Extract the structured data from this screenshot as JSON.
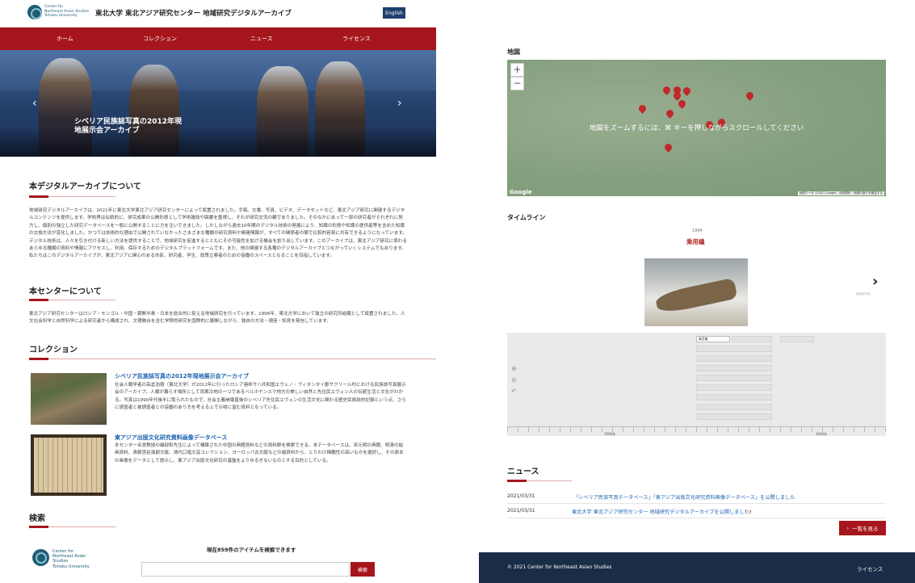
{
  "header": {
    "logo_text": "Center for\nNortheast Asian Studies\nTohoku University",
    "site_title": "東北大学 東北アジア研究センター 地域研究デジタルアーカイブ",
    "lang_button": "English"
  },
  "nav": {
    "items": [
      "ホーム",
      "コレクション",
      "ニュース",
      "ライセンス"
    ]
  },
  "hero": {
    "caption": "シベリア民族誌写真の2012年現\n地展示会アーカイブ",
    "prev": "‹",
    "next": "›"
  },
  "about": {
    "title": "本デジタルアーカイブについて",
    "text": "地域研究デジタルアーカイブは、2021年に東北大学東北アジア研究センターによって設置されました。手稿、文書、写真、ビデオ、データセットなど、東北アジア研究に関連するデジタルコンテンツを提供します。学術界は伝統的に、研究成果の公開形態として学術雑誌や図書を重視し、それが研究交流の鍵でありました。そのなかにあって一部の研究者がそれぞれに努力し、個別の独立した研究データベースを一般に公開することに力を注いできました。しかしながら過去10年間のデジタル技術の発展により、知識の形態や知識の提供者等を含めた知識の交換方法が変化しました。かつては技術的な理由で公開されていなかったさまざまな種類の研究資料や関連情報が、すべての関係者の間で比較的容易に共有できるようになっています。デジタル技術は、人々を引き付ける新しい方法を提供することで、地域研究を促進するとともにその可能性を拡げる機会を創り出しています。このアーカイブは、東北アジア研究に係わるあらゆる種類の資料や情報にアクセスし、利用、保存するためのデジタルプラットフォームです。また、他の関連する各種のデジタルアーカイブとつながっていくシステムでもあります。私たちはこのデジタルアーカイブが、東北アジアに関心のある市民、研究者、学生、政策立案者のための協働のスペースとなることを目指しています。"
  },
  "center": {
    "title": "本センターについて",
    "text": "東北アジア研究センターはロシア・モンゴル・中国・朝鮮半島・日本を総合的に捉える地域研究を行っています。1996年、東北大学において独立の研究所組織として設置されました。人文社会科学と自然科学による研究者から構成され、文理融合を含む学際的研究を国際的に展開しながら、独自の方法・視座・知見を発信しています。"
  },
  "collection": {
    "title": "コレクション",
    "items": [
      {
        "title": "シベリア民族誌写真の2012年現地展示会アーカイブ",
        "desc": "社会人類学者の高倉浩樹（東北大学）が2012年に行ったロシア連邦サハ共和国エヴェノ・ブィタンタイ郡サクリール村における民族誌写真展示会のアーカイブ。人類が暮らす場所として両寒冷地の一つであるベルホヤンスク地方の美しい自然と先住民エヴェン人の伝統生活と文化がわかる。写真は1990年代後半に取られたもので、社会主義崩壊直後のシベリア先住民エヴェンの生活文化に関わる歴史民族誌的記録という点、さらに調査者と被調査者との協働のあり方を考える上で示唆に富む資料となっている。"
      },
      {
        "title": "東アジア出版文化研究資料画像データベース",
        "desc": "本センター名誉教授の磯部彰先生によって構築された中国の典籍資料などの資料群を検索できる。本データベースは、宋元明の典籍、明清の絵画資料、清朝宮廷演劇文献、清代口唱文芸コレクション、ヨーロッパ古文献などの諸資料から、とりわけ稀覯性の高いものを選択し、その原本の画像をデータとして提示し、東アジア出版文化研究の基盤をよりゆるぎないものとする目的としている。"
      }
    ]
  },
  "search": {
    "title": "検索",
    "count_text": "現在859件のアイテムを検索できます",
    "button": "検索",
    "placeholder": ""
  },
  "map": {
    "title": "地図",
    "zoom_in": "+",
    "zoom_out": "−",
    "message": "地図をズームするには、⌘ キーを押しながらスクロールしてください",
    "google": "Google",
    "attribution": "地図データ ©2021 Google　利用規約　地図の誤りを報告する"
  },
  "timeline": {
    "title": "タイムライン",
    "year": "1994",
    "item_title": "乗用橇",
    "next": "›",
    "next_hint": "民族誌写真",
    "selected_event": "乗用橇",
    "axis_labels": [
      "1990年",
      "2000年"
    ]
  },
  "news": {
    "title": "ニュース",
    "items": [
      {
        "date": "2021/03/31",
        "text": "「シベリア民族写真データベース」「東アジア出版文化研究資料画像データベース」を公開しました"
      },
      {
        "date": "2021/03/31",
        "text": "東北大学 東北アジア研究センター 地域研究デジタルアーカイブを公開しました",
        "mark": "!"
      }
    ],
    "more_button": "一覧を見る"
  },
  "footer": {
    "copyright": "© 2021 Center for Northeast Asian Studies",
    "license": "ライセンス"
  },
  "colors": {
    "accent": "#a6161c",
    "link": "#1e63b0",
    "footer": "#1a2d47",
    "lang": "#1c3f6e"
  }
}
